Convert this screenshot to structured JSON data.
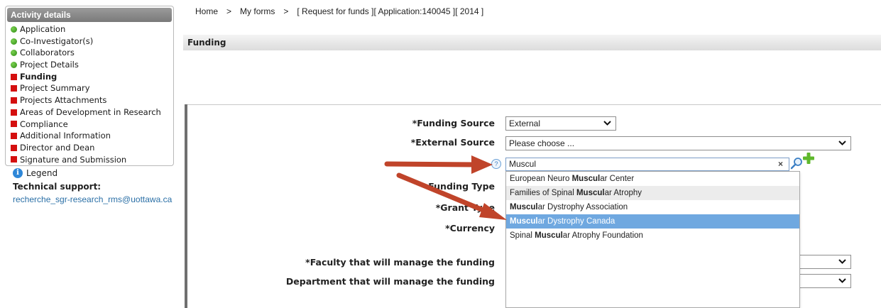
{
  "sidebar": {
    "header": "Activity details",
    "items": [
      {
        "label": "Application",
        "status": "complete"
      },
      {
        "label": "Co-Investigator(s)",
        "status": "complete"
      },
      {
        "label": "Collaborators",
        "status": "complete"
      },
      {
        "label": "Project Details",
        "status": "complete"
      },
      {
        "label": "Funding",
        "status": "incomplete",
        "active": true
      },
      {
        "label": "Project Summary",
        "status": "incomplete"
      },
      {
        "label": "Projects Attachments",
        "status": "incomplete"
      },
      {
        "label": "Areas of Development in Research",
        "status": "incomplete"
      },
      {
        "label": "Compliance",
        "status": "incomplete"
      },
      {
        "label": "Additional Information",
        "status": "incomplete"
      },
      {
        "label": "Director and Dean",
        "status": "incomplete"
      },
      {
        "label": "Signature and Submission",
        "status": "incomplete"
      }
    ],
    "legend": "Legend",
    "tech_support_label": "Technical support:",
    "tech_support_email": "recherche_sgr-research_rms@uottawa.ca"
  },
  "breadcrumb": {
    "home": "Home",
    "my_forms": "My forms",
    "current": "[ Request for funds ][ Application:140045 ][ 2014 ]",
    "separator": ">"
  },
  "section": {
    "title": "Funding"
  },
  "form": {
    "funding_source": {
      "label": "*Funding Source",
      "value": "External"
    },
    "external_source": {
      "label": "*External Source",
      "value": "Please choose ..."
    },
    "search": {
      "value": "Muscul",
      "clear": "×",
      "help": "?"
    },
    "funding_type": {
      "label": "Funding Type"
    },
    "grant_type": {
      "label": "*Grant Type"
    },
    "currency": {
      "label": "*Currency"
    },
    "faculty": {
      "label": "*Faculty that will manage the funding"
    },
    "department": {
      "label": "Department that will manage the funding"
    }
  },
  "dropdown": {
    "items": [
      {
        "pre": "European Neuro ",
        "match": "Muscul",
        "post": "ar Center"
      },
      {
        "pre": "Families of Spinal ",
        "match": "Muscul",
        "post": "ar Atrophy"
      },
      {
        "pre": "",
        "match": "Muscul",
        "post": "ar Dystrophy Association"
      },
      {
        "pre": "",
        "match": "Muscul",
        "post": "ar Dystrophy Canada",
        "highlighted": true
      },
      {
        "pre": "Spinal ",
        "match": "Muscul",
        "post": "ar Atrophy Foundation"
      }
    ]
  },
  "colors": {
    "complete": "#2d8a14",
    "incomplete": "#d40f0f",
    "highlight": "#6fa8e0",
    "arrow": "#c0442a"
  },
  "icons": [
    "green-dot-icon",
    "red-square-icon",
    "info-icon",
    "help-icon",
    "magnifier-icon",
    "plus-icon",
    "chevron-down-icon",
    "close-icon"
  ]
}
